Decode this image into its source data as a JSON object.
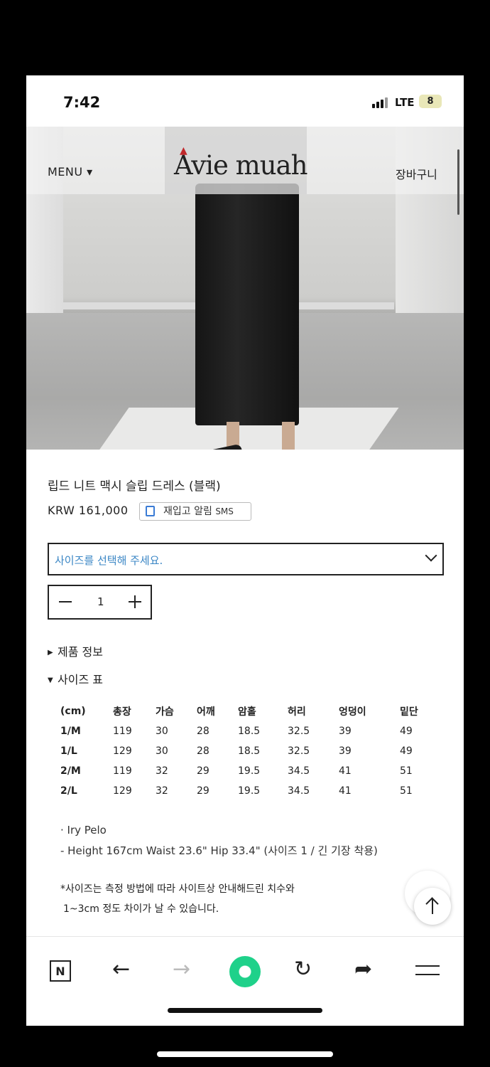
{
  "status_bar": {
    "time": "7:42",
    "network": "LTE",
    "battery": "8"
  },
  "header": {
    "menu_label": "MENU ▾",
    "brand": "Avie muah",
    "cart_label": "장바구니"
  },
  "product": {
    "title": "립드 니트 맥시 슬립 드레스 (블랙)",
    "price": "KRW 161,000",
    "restock_label": "재입고 알림",
    "restock_sms": "SMS",
    "size_placeholder": "사이즈를 선택해 주세요.",
    "quantity": "1"
  },
  "sections": {
    "info": "제품 정보",
    "size_chart": "사이즈 표"
  },
  "size_table": {
    "headers": [
      "(cm)",
      "총장",
      "가슴",
      "어깨",
      "암홀",
      "허리",
      "엉덩이",
      "밑단"
    ],
    "rows": [
      [
        "1/M",
        "119",
        "30",
        "28",
        "18.5",
        "32.5",
        "39",
        "49"
      ],
      [
        "1/L",
        "129",
        "30",
        "28",
        "18.5",
        "32.5",
        "39",
        "49"
      ],
      [
        "2/M",
        "119",
        "32",
        "29",
        "19.5",
        "34.5",
        "41",
        "51"
      ],
      [
        "2/L",
        "129",
        "32",
        "29",
        "19.5",
        "34.5",
        "41",
        "51"
      ]
    ]
  },
  "model_notes": {
    "name": "· Iry Pelo",
    "measurements": "- Height 167cm Waist 23.6\" Hip 33.4\" (사이즈 1 / 긴 기장 착용)"
  },
  "disclaimer": {
    "line1": "*사이즈는 측정 방법에 따라 사이트상 안내해드린 치수와",
    "line2": "1~3cm 정도 차이가 날 수 있습니다."
  },
  "bottom_bar": {
    "n_label": "N",
    "back": "←",
    "forward": "→",
    "reload": "↻",
    "share": "➦"
  },
  "icons": [
    "back-arrow-icon",
    "forward-arrow-icon",
    "green-circle-icon",
    "reload-icon",
    "share-icon",
    "hamburger-icon",
    "scroll-top-icon"
  ],
  "colors": {
    "accent_blue": "#3a86c5",
    "green": "#1fd18a"
  }
}
